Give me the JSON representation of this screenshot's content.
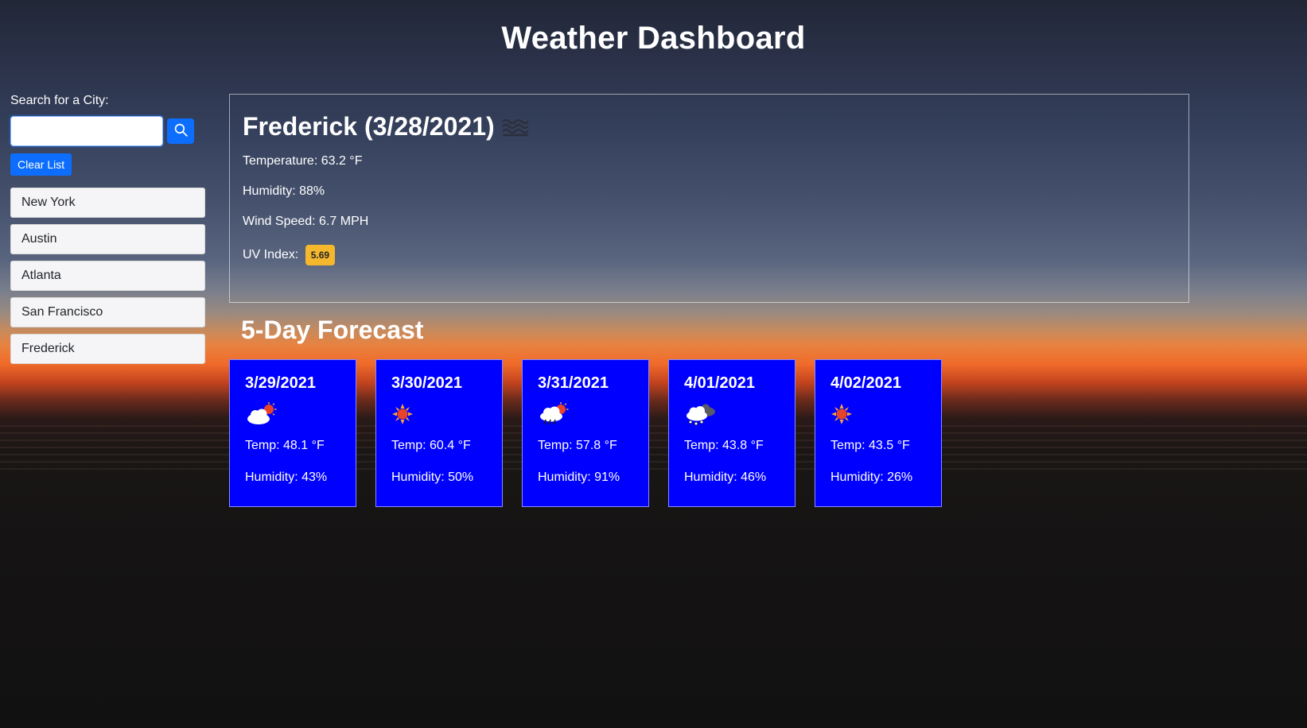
{
  "header": {
    "title": "Weather Dashboard"
  },
  "sidebar": {
    "search_label": "Search for a City:",
    "search_value": "",
    "search_button_icon": "search-icon",
    "clear_label": "Clear List",
    "cities": [
      "New York",
      "Austin",
      "Atlanta",
      "San Francisco",
      "Frederick"
    ]
  },
  "current": {
    "title": "Frederick (3/28/2021)",
    "icon": "mist-icon",
    "temperature": "Temperature: 63.2 °F",
    "humidity": "Humidity: 88%",
    "wind": "Wind Speed: 6.7 MPH",
    "uv_label": "UV Index:",
    "uv_value": "5.69",
    "uv_color": "#f5b72c"
  },
  "forecast": {
    "title": "5-Day Forecast",
    "card_color": "#0000ff",
    "days": [
      {
        "date": "3/29/2021",
        "icon": "partly-cloudy-icon",
        "temp": "Temp: 48.1 °F",
        "humidity": "Humidity: 43%"
      },
      {
        "date": "3/30/2021",
        "icon": "sun-icon",
        "temp": "Temp: 60.4 °F",
        "humidity": "Humidity: 50%"
      },
      {
        "date": "3/31/2021",
        "icon": "rain-sun-icon",
        "temp": "Temp: 57.8 °F",
        "humidity": "Humidity: 91%"
      },
      {
        "date": "4/01/2021",
        "icon": "snow-cloud-icon",
        "temp": "Temp: 43.8 °F",
        "humidity": "Humidity: 46%"
      },
      {
        "date": "4/02/2021",
        "icon": "sun-icon",
        "temp": "Temp: 43.5 °F",
        "humidity": "Humidity: 26%"
      }
    ]
  }
}
